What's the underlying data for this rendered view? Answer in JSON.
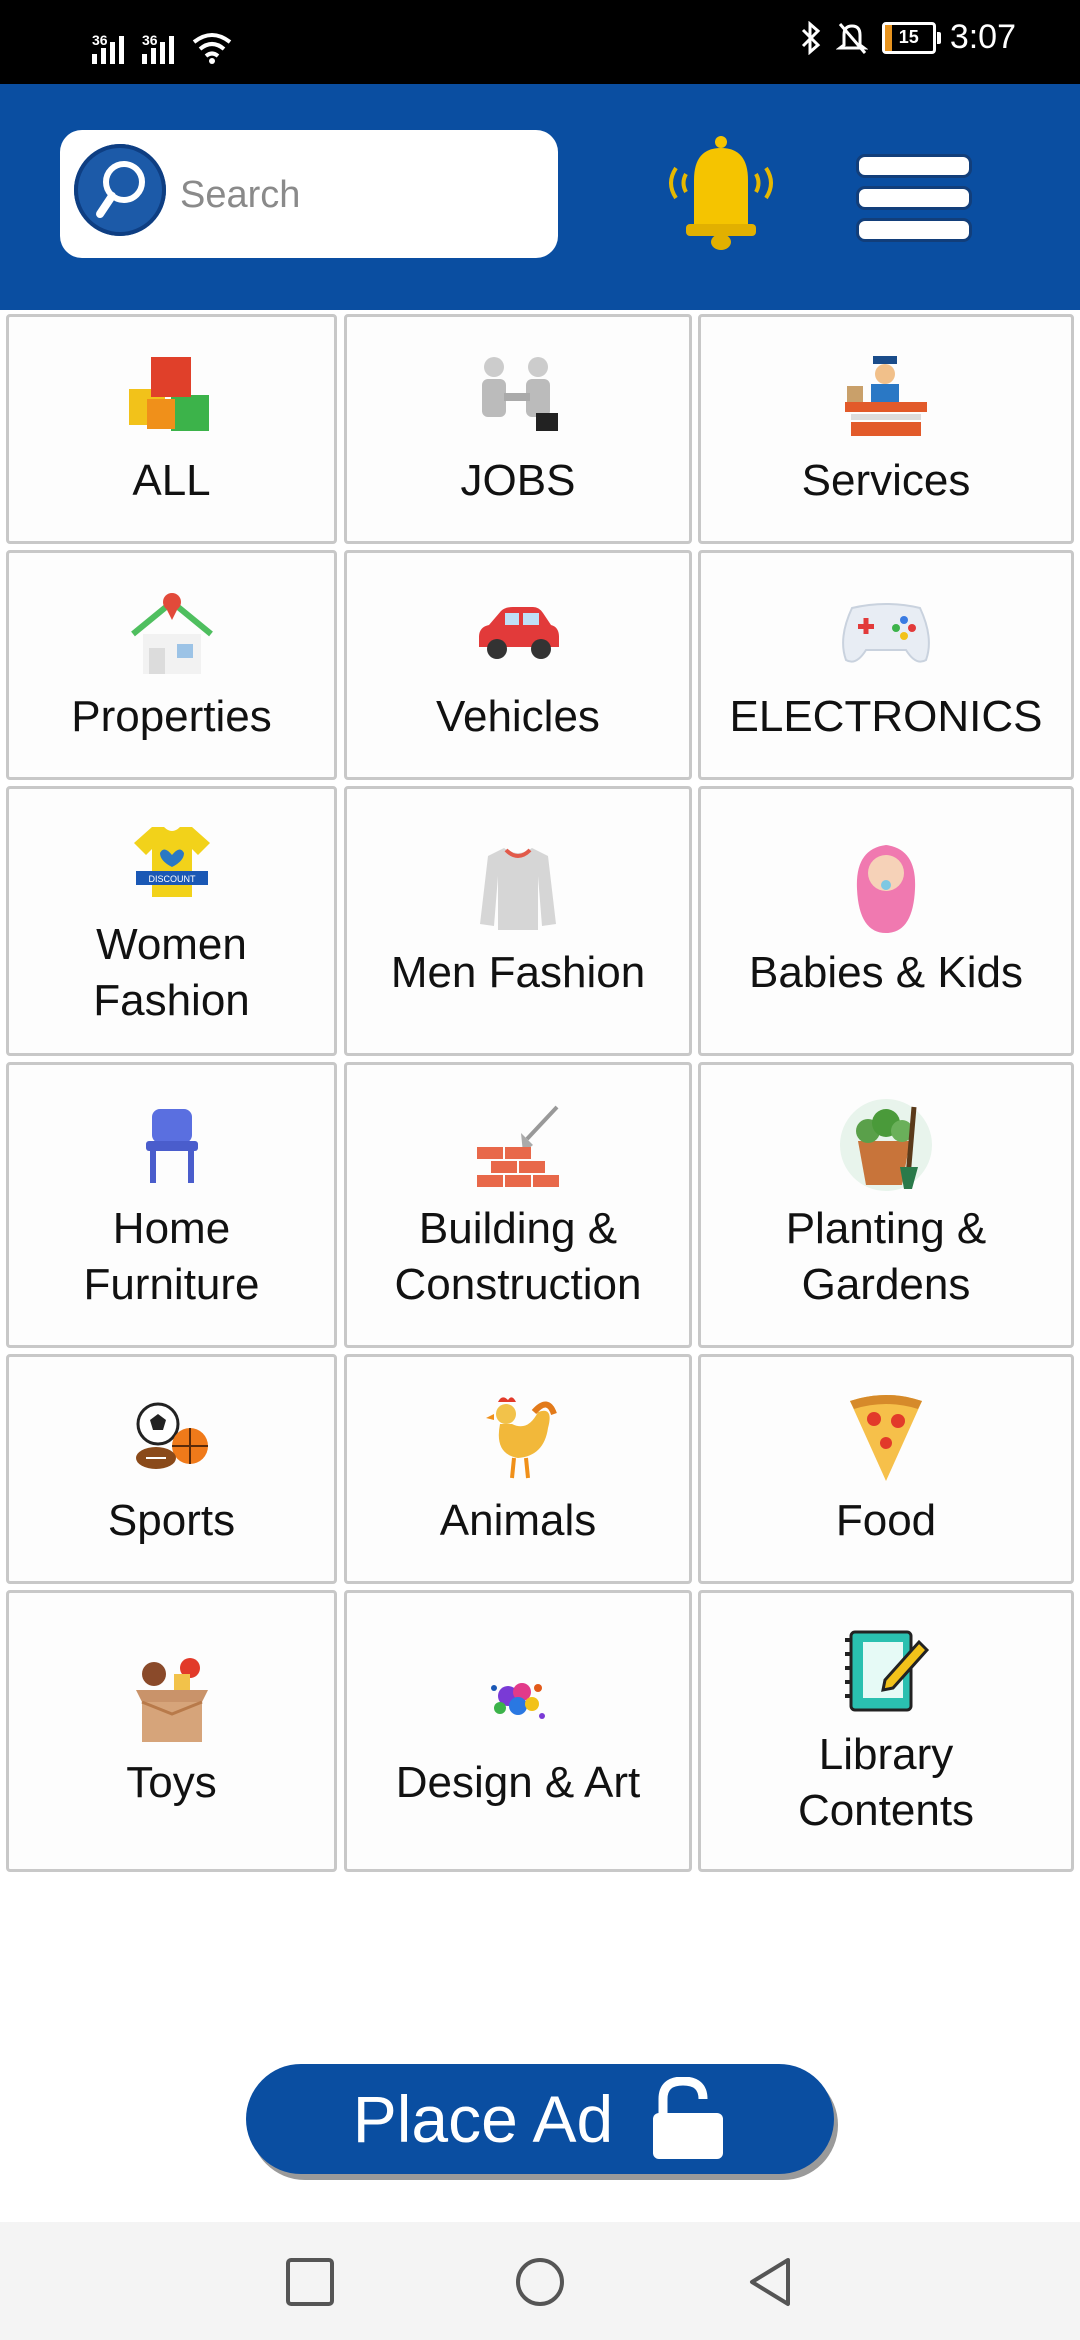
{
  "status_bar": {
    "network_1": "36",
    "network_2": "36",
    "battery": "15",
    "time": "3:07"
  },
  "header": {
    "search_placeholder": "Search"
  },
  "categories": [
    {
      "label": "ALL",
      "icon": "boxes-icon"
    },
    {
      "label": "JOBS",
      "icon": "handshake-icon"
    },
    {
      "label": "Services",
      "icon": "service-desk-icon"
    },
    {
      "label": "Properties",
      "icon": "house-icon"
    },
    {
      "label": "Vehicles",
      "icon": "car-icon"
    },
    {
      "label": "ELECTRONICS",
      "icon": "gamepad-icon"
    },
    {
      "label": "Women\nFashion",
      "icon": "tshirt-icon"
    },
    {
      "label": "Men Fashion",
      "icon": "sweater-icon"
    },
    {
      "label": "Babies & Kids",
      "icon": "baby-icon"
    },
    {
      "label": "Home\nFurniture",
      "icon": "chair-icon"
    },
    {
      "label": "Building &\nConstruction",
      "icon": "bricks-icon"
    },
    {
      "label": "Planting &\nGardens",
      "icon": "plant-pot-icon"
    },
    {
      "label": "Sports",
      "icon": "balls-icon"
    },
    {
      "label": "Animals",
      "icon": "rooster-icon"
    },
    {
      "label": "Food",
      "icon": "pizza-icon"
    },
    {
      "label": "Toys",
      "icon": "toy-box-icon"
    },
    {
      "label": "Design & Art",
      "icon": "paint-splash-icon"
    },
    {
      "label": "Library\nContents",
      "icon": "notebook-icon"
    }
  ],
  "place_ad": {
    "label": "Place Ad"
  },
  "colors": {
    "primary": "#0a4ea1",
    "bell": "#f5c400"
  }
}
